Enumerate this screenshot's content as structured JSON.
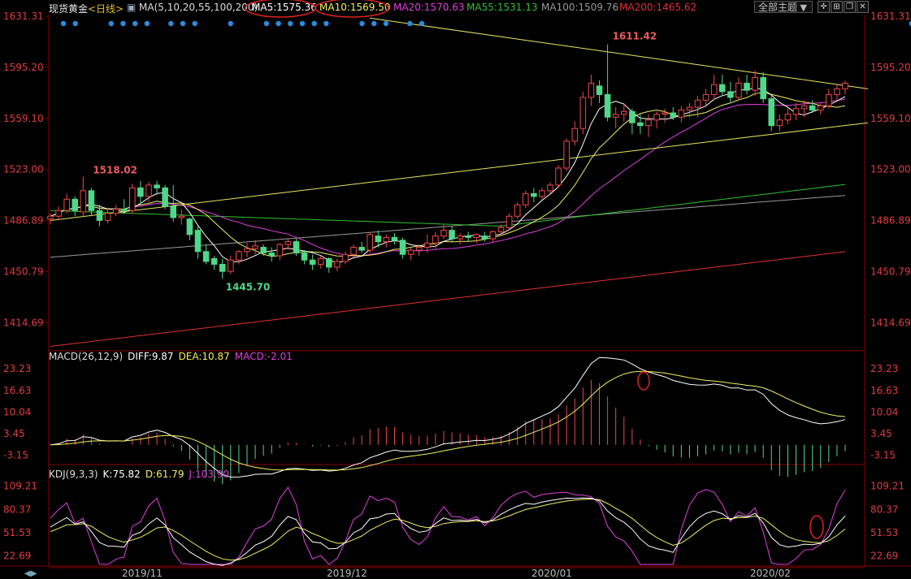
{
  "header": {
    "instrument": "现货黄金",
    "period": "<日线>",
    "ma_label": "MA(5,10,20,55,100,200)",
    "ma5": "MA5:1575.36",
    "ma10": "MA10:1569.50",
    "ma20": "MA20:1570.63",
    "ma55": "MA55:1531.13",
    "ma100": "MA100:1509.76",
    "ma200": "MA200:1465.62",
    "theme_button": "全部主题"
  },
  "colors": {
    "up": "#f04848",
    "down": "#4fd88a",
    "ma5": "#ffffff",
    "ma10": "#f0f060",
    "ma20": "#e040e0",
    "ma55": "#30c030",
    "ma100": "#9a9a9a",
    "ma200": "#e03030",
    "axis": "#e03c3c",
    "grid": "#8a0000"
  },
  "chart_data": [
    {
      "type": "candlestick",
      "title": "现货黄金 日线",
      "x_ticks": [
        "2019/11",
        "2019/12",
        "2020/01",
        "2020/02"
      ],
      "y_ticks": [
        "1631.31",
        "1595.20",
        "1559.10",
        "1523.00",
        "1486.89",
        "1450.79",
        "1414.69"
      ],
      "ylim": [
        1396,
        1631.31
      ],
      "annotations": [
        "1518.02",
        "1445.70",
        "1611.42"
      ],
      "candles": [
        [
          1488,
          1492,
          1484,
          1490
        ],
        [
          1490,
          1497,
          1488,
          1494
        ],
        [
          1494,
          1506,
          1492,
          1502
        ],
        [
          1502,
          1504,
          1490,
          1494
        ],
        [
          1493,
          1518,
          1490,
          1508
        ],
        [
          1508,
          1510,
          1490,
          1494
        ],
        [
          1494,
          1498,
          1483,
          1487
        ],
        [
          1487,
          1496,
          1485,
          1492
        ],
        [
          1492,
          1498,
          1490,
          1495
        ],
        [
          1495,
          1502,
          1492,
          1494
        ],
        [
          1494,
          1513,
          1492,
          1510
        ],
        [
          1510,
          1515,
          1498,
          1504
        ],
        [
          1504,
          1514,
          1500,
          1512
        ],
        [
          1512,
          1515,
          1505,
          1510
        ],
        [
          1510,
          1512,
          1495,
          1497
        ],
        [
          1497,
          1512,
          1486,
          1489
        ],
        [
          1489,
          1495,
          1484,
          1490
        ],
        [
          1488,
          1489,
          1473,
          1477
        ],
        [
          1480,
          1483,
          1460,
          1465
        ],
        [
          1465,
          1470,
          1456,
          1458
        ],
        [
          1460,
          1462,
          1452,
          1456
        ],
        [
          1456,
          1460,
          1445.7,
          1451
        ],
        [
          1451,
          1462,
          1449,
          1459
        ],
        [
          1459,
          1466,
          1456,
          1465
        ],
        [
          1465,
          1471,
          1461,
          1467
        ],
        [
          1467,
          1473,
          1463,
          1469
        ],
        [
          1468,
          1470,
          1462,
          1464
        ],
        [
          1464,
          1468,
          1458,
          1462
        ],
        [
          1462,
          1471,
          1459,
          1470
        ],
        [
          1470,
          1474,
          1466,
          1472
        ],
        [
          1472,
          1474,
          1462,
          1464
        ],
        [
          1464,
          1466,
          1456,
          1459
        ],
        [
          1459,
          1463,
          1452,
          1456
        ],
        [
          1456,
          1462,
          1453,
          1460
        ],
        [
          1460,
          1461,
          1450,
          1454
        ],
        [
          1454,
          1460,
          1451,
          1458
        ],
        [
          1458,
          1465,
          1456,
          1463
        ],
        [
          1463,
          1470,
          1461,
          1468
        ],
        [
          1468,
          1472,
          1464,
          1466
        ],
        [
          1466,
          1479,
          1464,
          1477
        ],
        [
          1476,
          1480,
          1468,
          1472
        ],
        [
          1472,
          1477,
          1468,
          1475
        ],
        [
          1475,
          1478,
          1470,
          1473
        ],
        [
          1473,
          1475,
          1460,
          1463
        ],
        [
          1463,
          1468,
          1459,
          1466
        ],
        [
          1466,
          1470,
          1462,
          1468
        ],
        [
          1468,
          1477,
          1464,
          1471
        ],
        [
          1471,
          1479,
          1467,
          1476
        ],
        [
          1476,
          1484,
          1474,
          1480
        ],
        [
          1480,
          1483,
          1472,
          1474
        ],
        [
          1474,
          1478,
          1470,
          1476
        ],
        [
          1476,
          1479,
          1472,
          1475
        ],
        [
          1475,
          1478,
          1471,
          1477
        ],
        [
          1476,
          1479,
          1472,
          1474
        ],
        [
          1474,
          1480,
          1472,
          1479
        ],
        [
          1479,
          1484,
          1477,
          1482
        ],
        [
          1482,
          1492,
          1480,
          1490
        ],
        [
          1490,
          1500,
          1488,
          1498
        ],
        [
          1498,
          1508,
          1496,
          1506
        ],
        [
          1506,
          1510,
          1500,
          1504
        ],
        [
          1504,
          1510,
          1502,
          1508
        ],
        [
          1508,
          1514,
          1506,
          1512
        ],
        [
          1512,
          1526,
          1510,
          1524
        ],
        [
          1524,
          1545,
          1522,
          1543
        ],
        [
          1543,
          1557,
          1540,
          1552
        ],
        [
          1552,
          1578,
          1548,
          1574
        ],
        [
          1574,
          1590,
          1568,
          1584
        ],
        [
          1582,
          1586,
          1570,
          1576
        ],
        [
          1576,
          1611.42,
          1557,
          1560
        ],
        [
          1560,
          1567,
          1552,
          1562
        ],
        [
          1562,
          1570,
          1557,
          1564
        ],
        [
          1564,
          1566,
          1548,
          1556
        ],
        [
          1556,
          1562,
          1548,
          1554
        ],
        [
          1554,
          1562,
          1546,
          1558
        ],
        [
          1558,
          1564,
          1552,
          1562
        ],
        [
          1562,
          1566,
          1556,
          1563
        ],
        [
          1563,
          1567,
          1558,
          1560
        ],
        [
          1560,
          1568,
          1556,
          1565
        ],
        [
          1565,
          1570,
          1560,
          1567
        ],
        [
          1567,
          1575,
          1560,
          1572
        ],
        [
          1572,
          1580,
          1567,
          1576
        ],
        [
          1576,
          1590,
          1572,
          1583
        ],
        [
          1583,
          1590,
          1575,
          1578
        ],
        [
          1578,
          1585,
          1570,
          1574
        ],
        [
          1574,
          1588,
          1572,
          1584
        ],
        [
          1584,
          1590,
          1576,
          1579
        ],
        [
          1579,
          1593,
          1575,
          1588
        ],
        [
          1588,
          1592,
          1570,
          1573
        ],
        [
          1573,
          1575,
          1550,
          1554
        ],
        [
          1554,
          1562,
          1550,
          1558
        ],
        [
          1558,
          1566,
          1555,
          1562
        ],
        [
          1562,
          1570,
          1558,
          1566
        ],
        [
          1566,
          1572,
          1560,
          1568
        ],
        [
          1568,
          1572,
          1563,
          1565
        ],
        [
          1565,
          1570,
          1562,
          1568
        ],
        [
          1568,
          1580,
          1566,
          1576
        ],
        [
          1576,
          1583,
          1572,
          1580
        ],
        [
          1580,
          1586,
          1576,
          1584
        ]
      ]
    },
    {
      "type": "macd",
      "title": "MACD(26,12,9)",
      "diff": "DIFF:9.87",
      "dea": "DEA:10.87",
      "macd": "MACD:-2.01",
      "y_ticks": [
        "23.23",
        "16.63",
        "10.04",
        "3.45",
        "-3.15"
      ],
      "ylim": [
        -5.5,
        25
      ]
    },
    {
      "type": "kdj",
      "title": "KDJ(9,3,3)",
      "k": "K:75.82",
      "d": "D:61.79",
      "j": "J:103.90",
      "y_ticks": [
        "109.21",
        "80.37",
        "51.53",
        "22.69"
      ],
      "ylim": [
        10,
        116
      ]
    }
  ]
}
